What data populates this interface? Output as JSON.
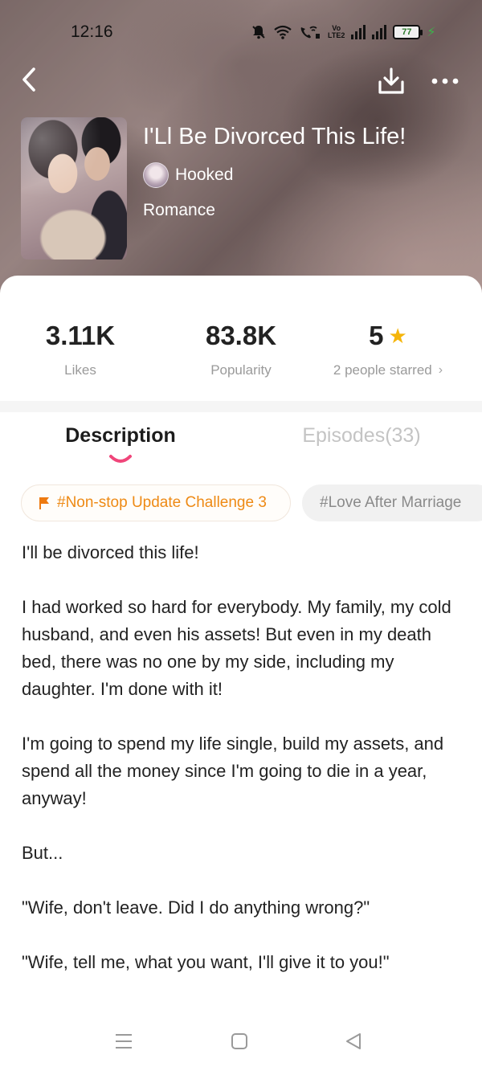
{
  "status_bar": {
    "time": "12:16",
    "battery": "77",
    "volte_top": "Vo",
    "volte_bottom": "LTE2"
  },
  "book": {
    "title": "I'Ll Be Divorced This Life!",
    "author": "Hooked",
    "genre": "Romance"
  },
  "stats": {
    "likes_value": "3.11K",
    "likes_label": "Likes",
    "popularity_value": "83.8K",
    "popularity_label": "Popularity",
    "rating_value": "5",
    "rating_label": "2 people starred"
  },
  "tabs": {
    "description": "Description",
    "episodes": "Episodes(33)"
  },
  "tags": {
    "primary": "#Non-stop Update Challenge 3",
    "secondary": "#Love After Marriage"
  },
  "description": {
    "p1": "I'll be divorced this life!",
    "p2": "I had worked so hard for everybody. My family, my cold husband, and even his assets! But even in my death bed, there was no one by my side, including my daughter. I'm done with it!",
    "p3": "I'm going to spend my life single, build my assets, and spend all the money since I'm going to die in a year, anyway!",
    "p4": "But...",
    "p5": "\"Wife, don't leave. Did I do anything wrong?\"",
    "p6": "\"Wife, tell me, what you want, I'll give it to you!\""
  },
  "colors": {
    "accent_pink": "#f0457a",
    "tag_orange": "#ee8a15",
    "star": "#f5b50a"
  }
}
